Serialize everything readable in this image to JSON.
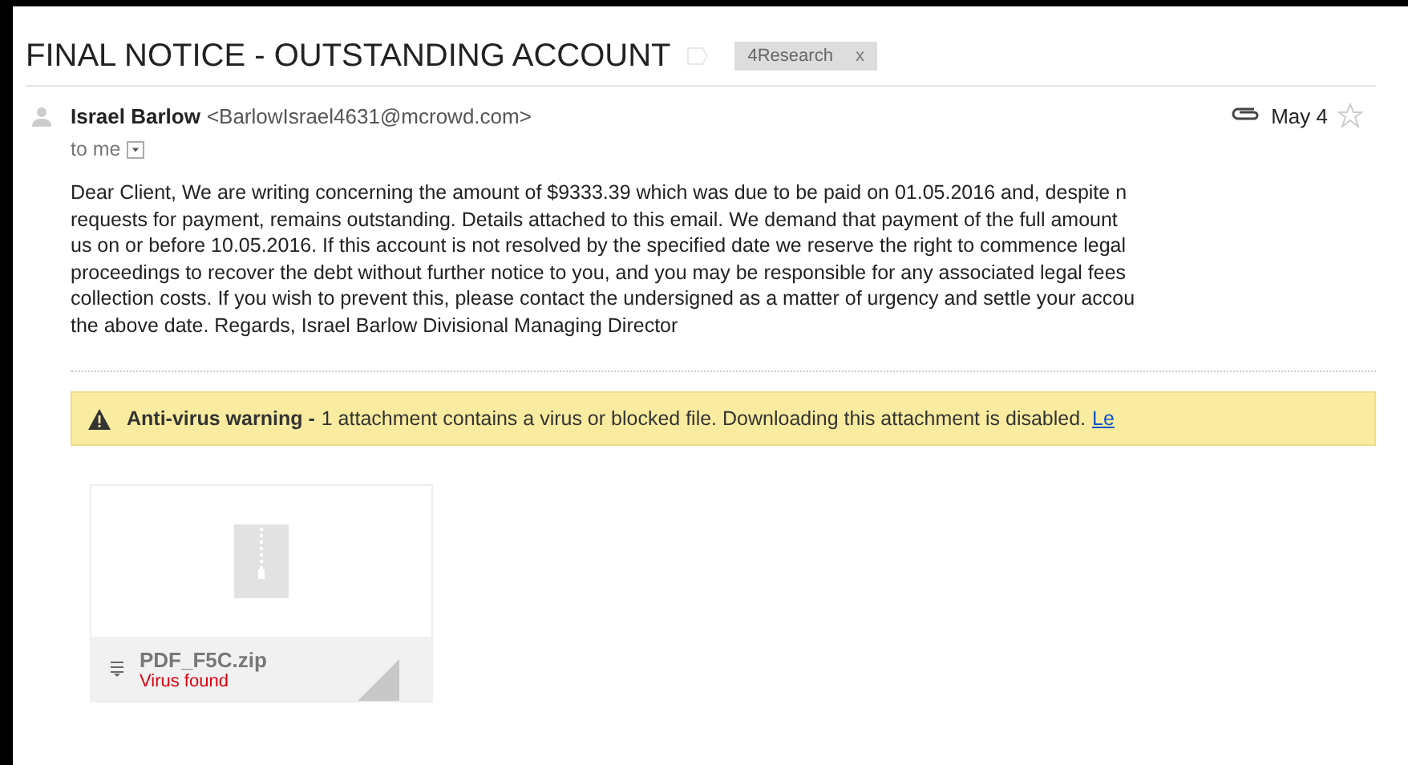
{
  "subject": "FINAL NOTICE - OUTSTANDING ACCOUNT",
  "label": {
    "text": "4Research",
    "remove": "x"
  },
  "message": {
    "sender_name": "Israel Barlow",
    "sender_email": "<BarlowIsrael4631@mcrowd.com>",
    "date": "May 4",
    "starred": false,
    "recipient": "to me",
    "body_lines": [
      "Dear Client, We are writing concerning the amount of $9333.39 which was due to be paid on 01.05.2016 and, despite n",
      "requests for payment, remains outstanding. Details attached to this email. We demand that payment of the full amount",
      "us on or before 10.05.2016. If this account is not resolved by the specified date we reserve the right to commence legal",
      "proceedings to recover the debt without further notice to you, and you may be responsible for any associated legal fees",
      "collection costs. If you wish to prevent this, please contact the undersigned as a matter of urgency and settle your accou",
      "the above date. Regards, Israel Barlow Divisional Managing Director"
    ]
  },
  "warning": {
    "title": "Anti-virus warning -",
    "text": "1 attachment contains a virus or blocked file. Downloading this attachment is disabled.",
    "link": "Le"
  },
  "attachments": [
    {
      "name": "PDF_F5C.zip",
      "status": "Virus found"
    }
  ]
}
